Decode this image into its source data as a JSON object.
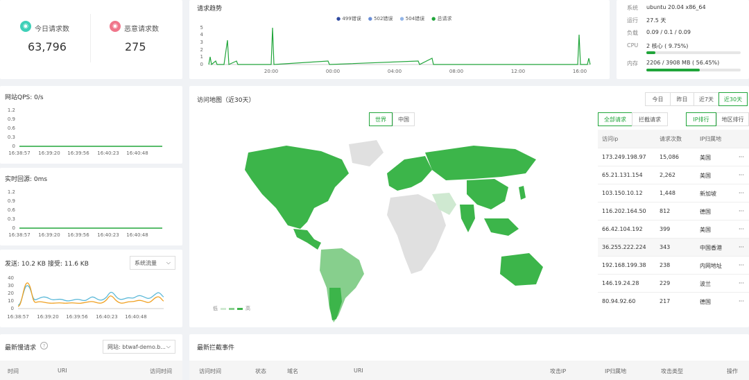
{
  "stats": {
    "today": {
      "label": "今日请求数",
      "value": "63,796"
    },
    "malicious": {
      "label": "恶意请求数",
      "value": "275"
    }
  },
  "trend": {
    "title": "请求趋势",
    "legend": [
      "499错误",
      "502错误",
      "504错误",
      "总请求"
    ],
    "legend_colors": [
      "#2f4aa0",
      "#6a8ed6",
      "#93b6e8",
      "#20a53a"
    ],
    "y_ticks": [
      "5",
      "4",
      "3",
      "2",
      "1",
      "0"
    ],
    "x_ticks": [
      "20:00",
      "00:00",
      "04:00",
      "08:00",
      "12:00",
      "16:00"
    ]
  },
  "system": {
    "os_label": "系统",
    "os_value": "ubuntu 20.04 x86_64",
    "uptime_label": "运行",
    "uptime_value": "27.5 天",
    "load_label": "负载",
    "load_value": "0.09 / 0.1 / 0.09",
    "cpu_label": "CPU",
    "cpu_value": "2 核心 ( 9.75%)",
    "cpu_percent": 9.75,
    "mem_label": "内存",
    "mem_value": "2206 / 3908 MB ( 56.45%)",
    "mem_percent": 56.45
  },
  "qps": {
    "title": "网站QPS: 0/s",
    "y_ticks": [
      "1.2",
      "0.9",
      "0.6",
      "0.3",
      "0"
    ],
    "x_ticks": [
      "16:38:57",
      "16:39:20",
      "16:39:56",
      "16:40:23",
      "16:40:48"
    ]
  },
  "latency": {
    "title": "实时回源: 0ms",
    "y_ticks": [
      "1.2",
      "0.9",
      "0.6",
      "0.3",
      "0"
    ],
    "x_ticks": [
      "16:38:57",
      "16:39:20",
      "16:39:56",
      "16:40:23",
      "16:40:48"
    ]
  },
  "traffic": {
    "send": "发送: 10.2 KB",
    "recv": "接受: 11.6 KB",
    "select": "系统流量",
    "y_ticks": [
      "40",
      "30",
      "20",
      "10",
      "0"
    ],
    "x_ticks": [
      "16:38:57",
      "16:39:20",
      "16:39:56",
      "16:40:23",
      "16:40:48"
    ]
  },
  "map": {
    "title": "访问地图（近30天）",
    "range_buttons": [
      "今日",
      "昨日",
      "近7天",
      "近30天"
    ],
    "view_buttons": [
      "世界",
      "中国"
    ],
    "legend_low": "低",
    "legend_high": "高"
  },
  "ip_table": {
    "filter_buttons": [
      "全部请求",
      "拦截请求"
    ],
    "rank_buttons": [
      "IP排行",
      "地区排行"
    ],
    "headers": [
      "访问ip",
      "请求次数",
      "IP归属地"
    ],
    "more": "···",
    "rows": [
      {
        "ip": "173.249.198.97",
        "count": "15,086",
        "loc": "美国"
      },
      {
        "ip": "65.21.131.154",
        "count": "2,262",
        "loc": "美国"
      },
      {
        "ip": "103.150.10.12",
        "count": "1,448",
        "loc": "新加坡"
      },
      {
        "ip": "116.202.164.50",
        "count": "812",
        "loc": "德国"
      },
      {
        "ip": "66.42.104.192",
        "count": "399",
        "loc": "美国"
      },
      {
        "ip": "36.255.222.224",
        "count": "343",
        "loc": "中国香港"
      },
      {
        "ip": "192.168.199.38",
        "count": "238",
        "loc": "内网地址"
      },
      {
        "ip": "146.19.24.28",
        "count": "229",
        "loc": "波兰"
      },
      {
        "ip": "80.94.92.60",
        "count": "217",
        "loc": "德国"
      }
    ]
  },
  "slow": {
    "title": "最新慢请求",
    "select": "网站: btwaf-demo.b...",
    "headers": [
      "时间",
      "URI",
      "访问时间"
    ]
  },
  "intercept": {
    "title": "最新拦截事件",
    "headers": [
      "访问时间",
      "状态",
      "域名",
      "URI",
      "攻击IP",
      "IP归属地",
      "攻击类型",
      "操作"
    ]
  }
}
